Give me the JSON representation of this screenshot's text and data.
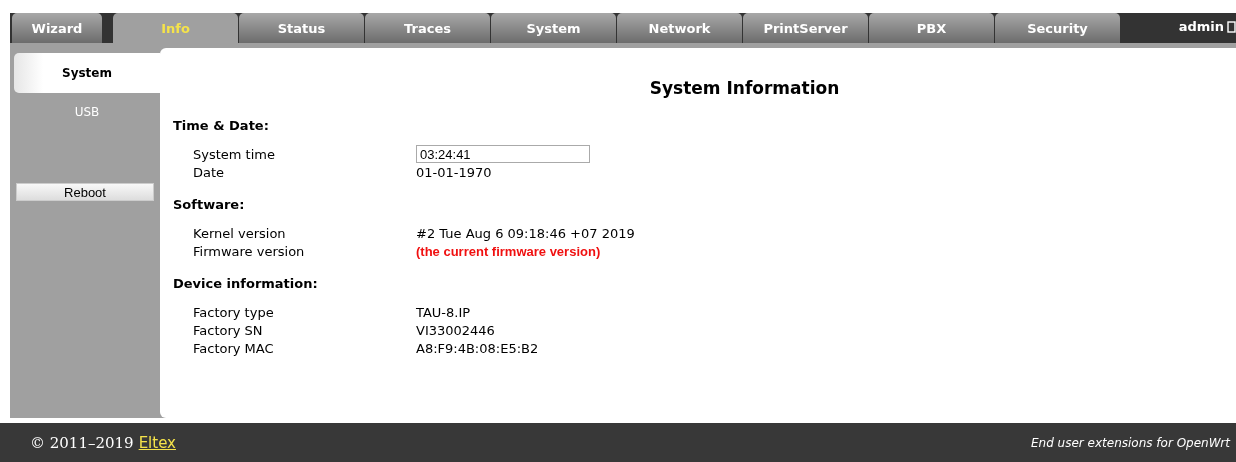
{
  "tabs": [
    {
      "label": "Wizard",
      "selected": false
    },
    {
      "label": "Info",
      "selected": true
    },
    {
      "label": "Status",
      "selected": false
    },
    {
      "label": "Traces",
      "selected": false
    },
    {
      "label": "System",
      "selected": false
    },
    {
      "label": "Network",
      "selected": false
    },
    {
      "label": "PrintServer",
      "selected": false
    },
    {
      "label": "PBX",
      "selected": false
    },
    {
      "label": "Security",
      "selected": false
    }
  ],
  "user": "admin",
  "sidebar": {
    "items": [
      {
        "label": "System",
        "selected": true
      },
      {
        "label": "USB",
        "selected": false
      }
    ],
    "reboot_button": "Reboot"
  },
  "title": "System Information",
  "sections": [
    {
      "heading": "Time & Date:",
      "rows": [
        {
          "kind": "input",
          "label": "System time",
          "value": "03:24:41"
        },
        {
          "kind": "text",
          "label": "Date",
          "value": "01-01-1970"
        }
      ]
    },
    {
      "heading": "Software:",
      "rows": [
        {
          "kind": "text",
          "label": "Kernel version",
          "value": "#2 Tue Aug 6 09:18:46 +07 2019"
        },
        {
          "kind": "warning",
          "label": "Firmware version",
          "value": "(the current firmware version)"
        }
      ]
    },
    {
      "heading": "Device information:",
      "rows": [
        {
          "kind": "text",
          "label": "Factory type",
          "value": "TAU-8.IP"
        },
        {
          "kind": "text",
          "label": "Factory SN",
          "value": "VI33002446"
        },
        {
          "kind": "text",
          "label": "Factory MAC",
          "value": "A8:F9:4B:08:E5:B2"
        }
      ]
    }
  ],
  "footer": {
    "copyright": "© 2011–2019",
    "link": "Eltex",
    "note": "End user extensions for OpenWrt"
  }
}
